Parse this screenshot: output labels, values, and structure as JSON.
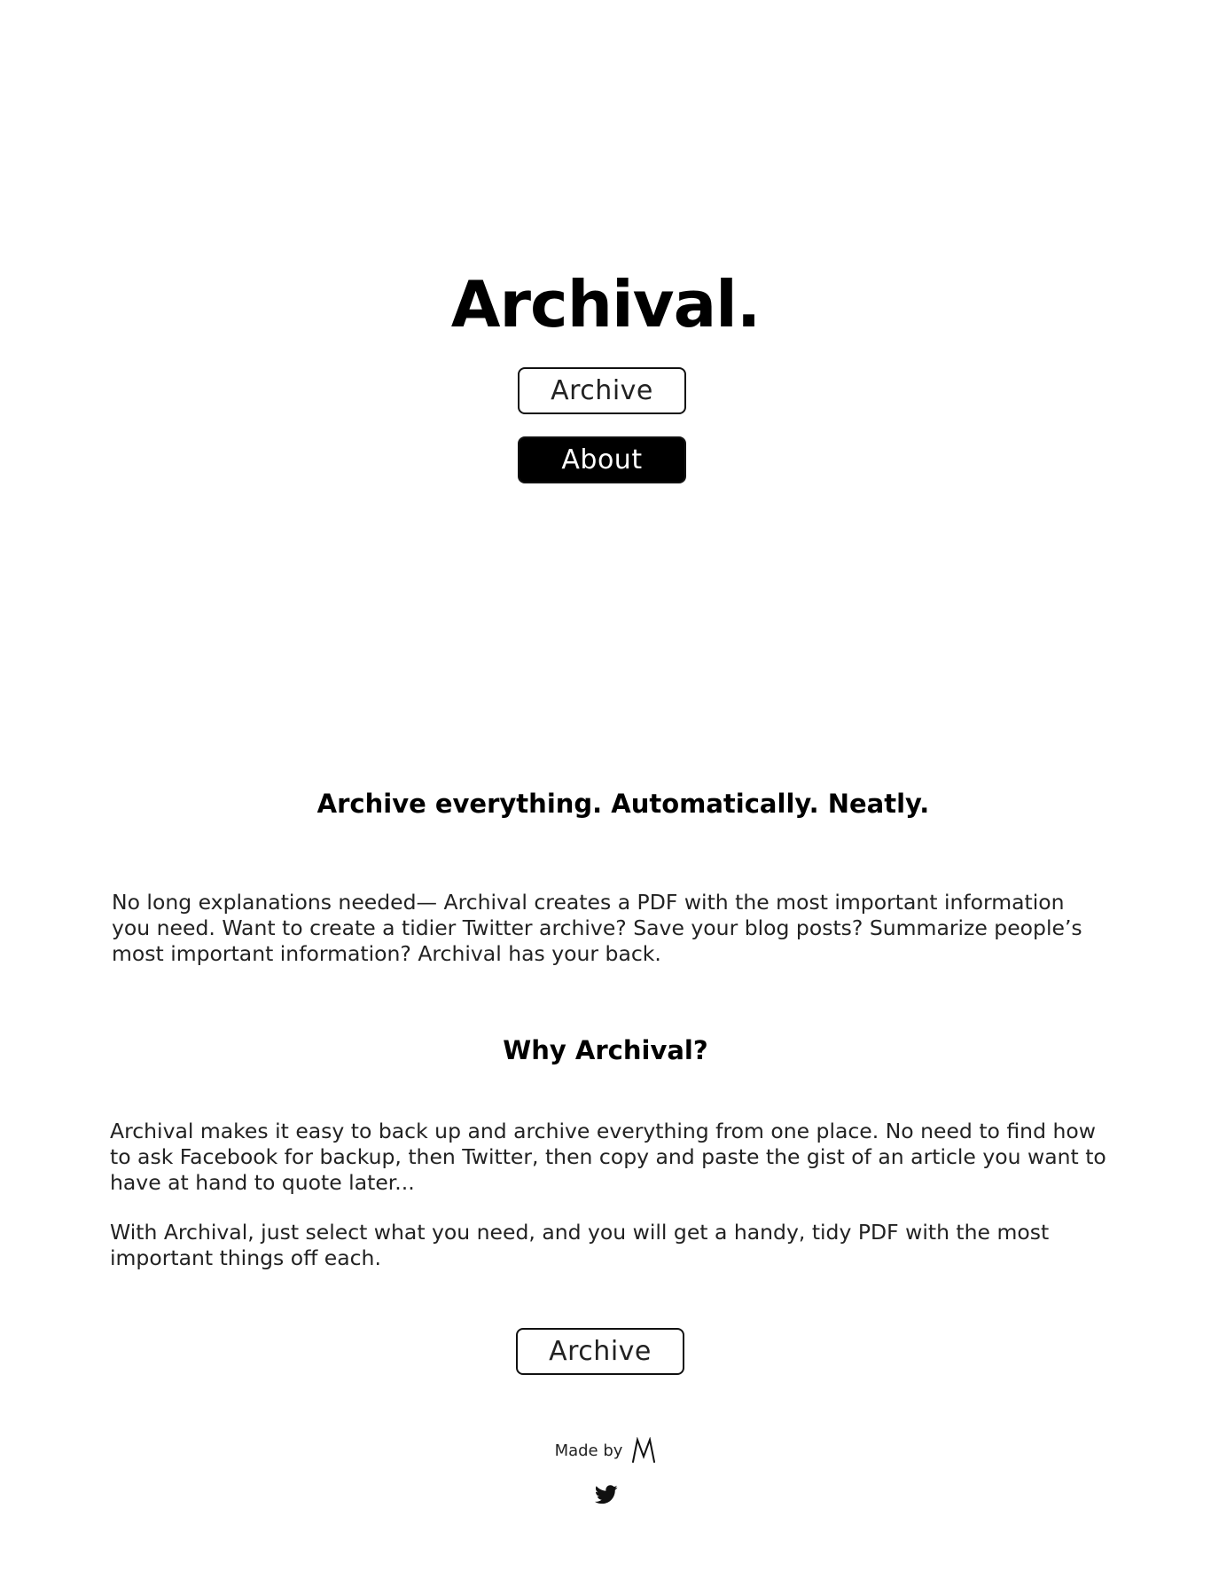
{
  "hero": {
    "title": "Archival."
  },
  "nav": {
    "archive_label": "Archive",
    "about_label": "About"
  },
  "sections": {
    "tagline": "Archive everything. Automatically. Neatly.",
    "intro": "No long explanations needed— Archival creates a PDF with the most important information you need. Want to create a tidier Twitter archive? Save your blog posts? Summarize people’s most important information? Archival has your back.",
    "why_heading": "Why Archival?",
    "why_paragraph_1": "Archival makes it easy to back up and archive everything from one place. No need to find how to ask Facebook for backup, then Twitter, then copy and paste the gist of an article you want to have at hand to quote later...",
    "why_paragraph_2": "With Archival, just select what you need, and you will get a handy, tidy PDF with the most important things off each."
  },
  "cta": {
    "archive_label": "Archive"
  },
  "footer": {
    "made_by": "Made by",
    "maker_logo_icon": "m-monogram-icon",
    "social_icon": "twitter-icon"
  },
  "colors": {
    "text": "#000000",
    "button_solid_bg": "#000000",
    "button_solid_text": "#ffffff",
    "background": "#ffffff"
  }
}
